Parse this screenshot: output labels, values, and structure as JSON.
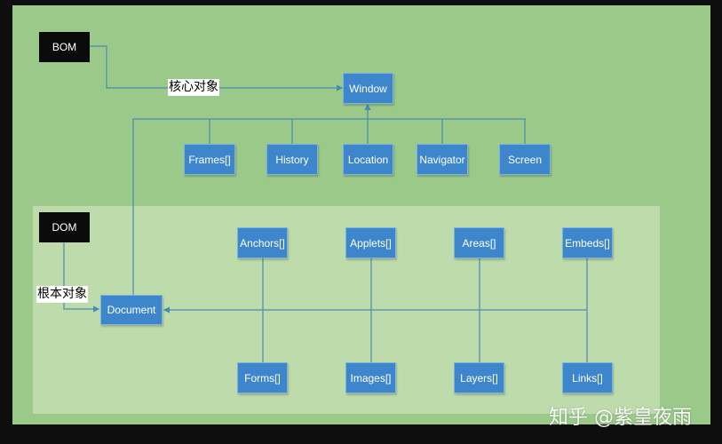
{
  "colors": {
    "background": "#9ac98a",
    "dom_panel": "#bedcab",
    "box": "#3d86cc",
    "line": "#4a8bb0",
    "root": "#0b0b0b"
  },
  "bom": {
    "label": "BOM",
    "edge_label": "核心对象",
    "core": "Window",
    "children": [
      "Frames[]",
      "History",
      "Location",
      "Navigator",
      "Screen"
    ]
  },
  "dom": {
    "label": "DOM",
    "edge_label": "根本对象",
    "root": "Document",
    "top_children": [
      "Anchors[]",
      "Applets[]",
      "Areas[]",
      "Embeds[]"
    ],
    "bottom_children": [
      "Forms[]",
      "Images[]",
      "Layers[]",
      "Links[]"
    ]
  },
  "watermark": "知乎 @紫皇夜雨"
}
